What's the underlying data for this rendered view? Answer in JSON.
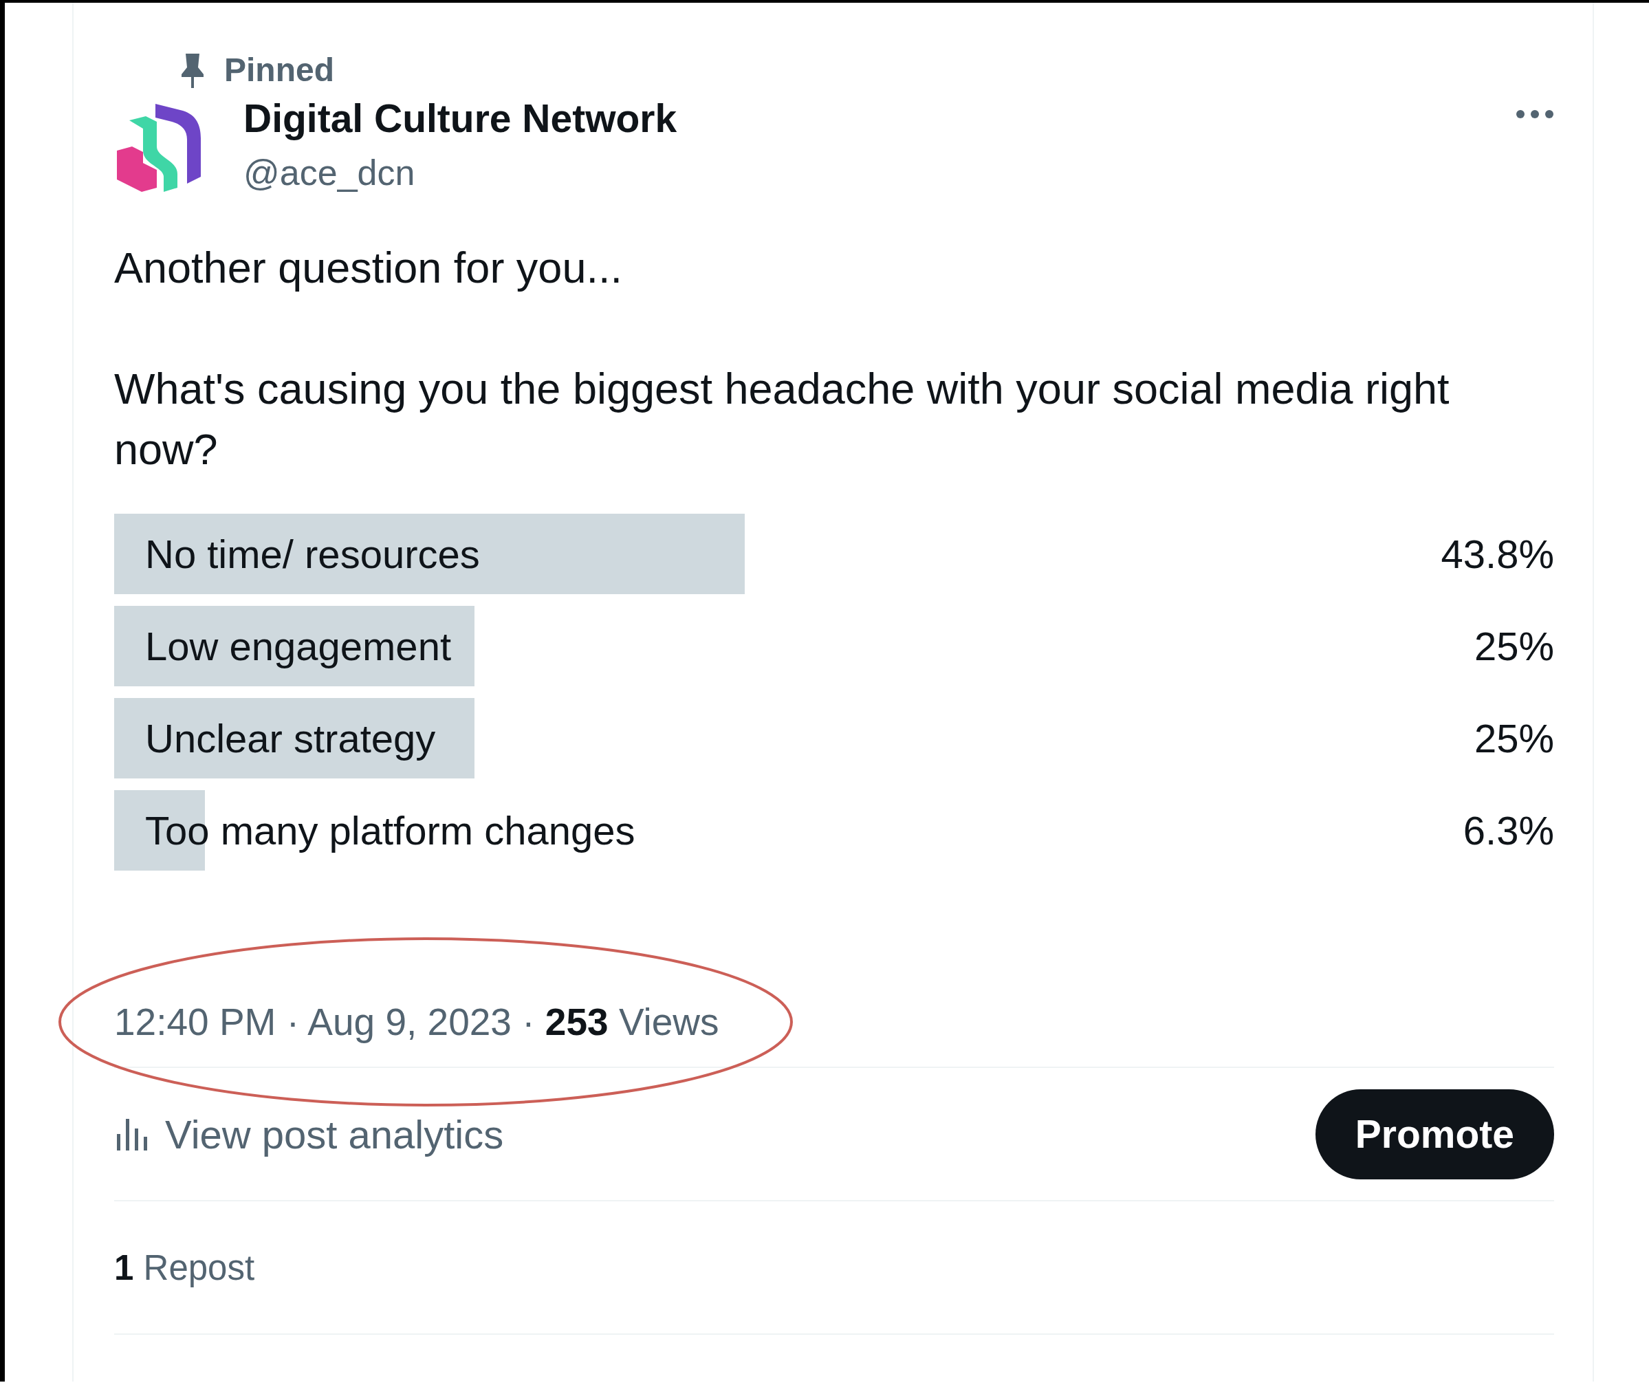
{
  "post": {
    "pinned_label": "Pinned",
    "author_name": "Digital Culture Network",
    "author_handle": "@ace_dcn",
    "text_lines": [
      "Another question for you...",
      "What's causing you the biggest headache with your social media right now?"
    ],
    "poll": [
      {
        "label": "No time/ resources",
        "percent": "43.8%"
      },
      {
        "label": "Low engagement",
        "percent": "25%"
      },
      {
        "label": "Unclear strategy",
        "percent": "25%"
      },
      {
        "label": "Too many platform changes",
        "percent": "6.3%"
      }
    ],
    "time": "12:40 PM",
    "separator_1": "·",
    "date": "Aug 9, 2023",
    "separator_2": "·",
    "views_count": "253",
    "views_label": "Views",
    "highlighted": true,
    "analytics_label": "View post analytics",
    "promote_button": "Promote",
    "repost_count": "1",
    "repost_label": "Repost"
  }
}
